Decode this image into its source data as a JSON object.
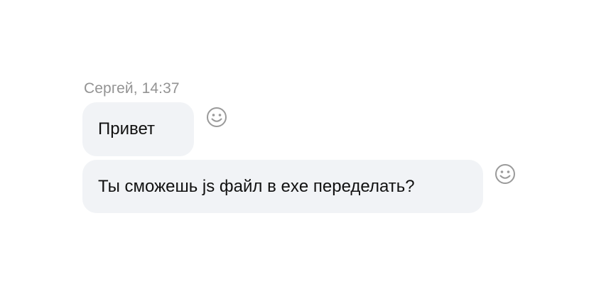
{
  "message_group": {
    "sender": "Сергей",
    "time": "14:37",
    "sender_line": "Сергей, 14:37"
  },
  "messages": [
    {
      "text": "Привет",
      "reaction_icon": "smiley-face-icon"
    },
    {
      "text": "Ты сможешь js файл в exe переделать?",
      "reaction_icon": "smiley-face-icon"
    }
  ],
  "colors": {
    "bubble_background": "#f1f3f6",
    "sender_text": "#939393",
    "icon_stroke": "#9a9a9a",
    "message_text": "#111111"
  }
}
